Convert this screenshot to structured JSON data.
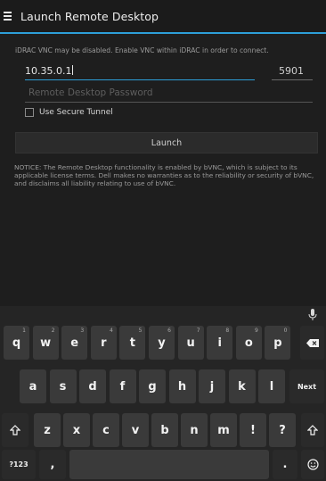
{
  "app": {
    "title": "Launch Remote Desktop"
  },
  "form": {
    "notice_top": "iDRAC VNC may be disabled. Enable VNC within iDRAC in order to connect.",
    "host_value": "10.35.0.1",
    "port_value": "5901",
    "password_placeholder": "Remote Desktop Password",
    "secure_tunnel_label": "Use Secure Tunnel",
    "launch_label": "Launch",
    "notice_body": "NOTICE: The Remote Desktop functionality is enabled by bVNC, which is subject to its applicable license terms. Dell makes no warranties as to the reliability or security of bVNC, and disclaims all liability relating to use of bVNC."
  },
  "keyboard": {
    "row1": [
      {
        "label": "q",
        "hint": "1"
      },
      {
        "label": "w",
        "hint": "2"
      },
      {
        "label": "e",
        "hint": "3"
      },
      {
        "label": "r",
        "hint": "4"
      },
      {
        "label": "t",
        "hint": "5"
      },
      {
        "label": "y",
        "hint": "6"
      },
      {
        "label": "u",
        "hint": "7"
      },
      {
        "label": "i",
        "hint": "8"
      },
      {
        "label": "o",
        "hint": "9"
      },
      {
        "label": "p",
        "hint": "0"
      }
    ],
    "row2": [
      "a",
      "s",
      "d",
      "f",
      "g",
      "h",
      "j",
      "k",
      "l"
    ],
    "row3": [
      "z",
      "x",
      "c",
      "v",
      "b",
      "n",
      "m",
      "!",
      "?"
    ],
    "next_label": "Next",
    "symbols_label": "?123",
    "comma_label": ",",
    "period_label": "."
  }
}
